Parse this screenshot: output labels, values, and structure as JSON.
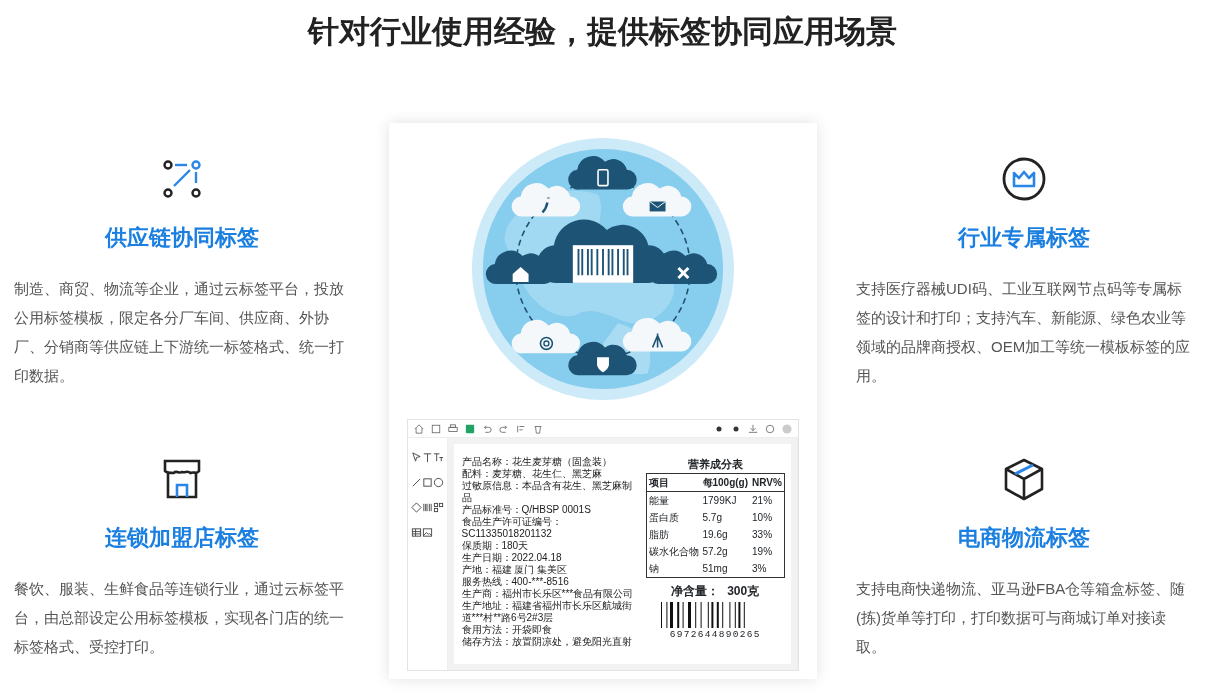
{
  "title": "针对行业使用经验，提供标签协同应用场景",
  "left_column": [
    {
      "heading": "供应链协同标签",
      "description": "制造、商贸、物流等企业，通过云标签平台，投放公用标签模板，限定各分厂车间、供应商、外协厂、分销商等供应链上下游统一标签格式、统一打印数据。"
    },
    {
      "heading": "连锁加盟店标签",
      "description": "餐饮、服装、生鲜食品等连锁行业，通过云标签平台，由总部设定公用标签模板，实现各门店的统一标签格式、受控打印。"
    }
  ],
  "right_column": [
    {
      "heading": "行业专属标签",
      "description": "支持医疗器械UDI码、工业互联网节点码等专属标签的设计和打印；支持汽车、新能源、绿色农业等领域的品牌商授权、OEM加工等统一模板标签的应用。"
    },
    {
      "heading": "电商物流标签",
      "description": "支持电商快递物流、亚马逊FBA仓等箱盒标签、随(拣)货单等打印，打印数据可与商城订单对接读取。"
    }
  ],
  "label_preview": {
    "lines": [
      "产品名称：花生麦芽糖（固盒装）",
      "配料：麦芽糖、花生仁、黑芝麻",
      "过敏原信息：本品含有花生、黑芝麻制品",
      "产品标准号：Q/HBSP 0001S",
      "食品生产许可证编号：SC11335018201132",
      "保质期：180天",
      "生产日期：2022.04.18",
      "产地：福建 厦门 集美区",
      "服务热线：400-***-8516",
      "生产商：福州市长乐区***食品有限公司",
      "生产地址：福建省福州市长乐区航城街道***村**路6号2#3层",
      "食用方法：开袋即食",
      "储存方法：放置阴凉处，避免阳光直射"
    ],
    "nutrition_table": {
      "title": "营养成分表",
      "columns": [
        "项目",
        "每100g(g)",
        "NRV%"
      ],
      "rows": [
        [
          "能量",
          "1799KJ",
          "21%"
        ],
        [
          "蛋白质",
          "5.7g",
          "10%"
        ],
        [
          "脂肪",
          "19.6g",
          "33%"
        ],
        [
          "碳水化合物",
          "57.2g",
          "19%"
        ],
        [
          "钠",
          "51mg",
          "3%"
        ]
      ]
    },
    "net_content": {
      "label": "净含量：",
      "value": "300克"
    },
    "barcode_number": "6972644890265"
  }
}
